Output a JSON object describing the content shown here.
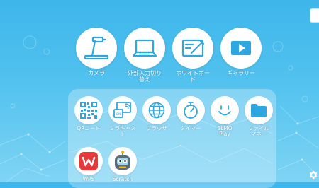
{
  "main_functions": [
    {
      "label": "カメラ",
      "icon": "document-camera-icon"
    },
    {
      "label": "外部入力切り\n替え",
      "icon": "laptop-icon"
    },
    {
      "label": "ホワイトボー\nド",
      "icon": "whiteboard-pen-icon"
    },
    {
      "label": "ギャラリー",
      "icon": "play-icon"
    }
  ],
  "apps": [
    {
      "label": "QRコード",
      "icon": "qr-code-icon"
    },
    {
      "label": "ミラキャス\nト",
      "icon": "cast-screen-icon"
    },
    {
      "label": "ブラウザ",
      "icon": "globe-icon"
    },
    {
      "label": "タイマー",
      "icon": "stopwatch-icon"
    },
    {
      "label": "ELMO\nPlay",
      "icon": "smiley-icon"
    },
    {
      "label": "ファイル\nマネー",
      "icon": "folder-icon"
    },
    {
      "label": "WPS",
      "icon": "wps-office-icon"
    },
    {
      "label": "Scratch",
      "icon": "scratch-robot-icon"
    }
  ],
  "colors": {
    "background_top": "#3eb6ea",
    "icon_blue": "#2ea7e0",
    "wps_red": "#e7383a"
  }
}
